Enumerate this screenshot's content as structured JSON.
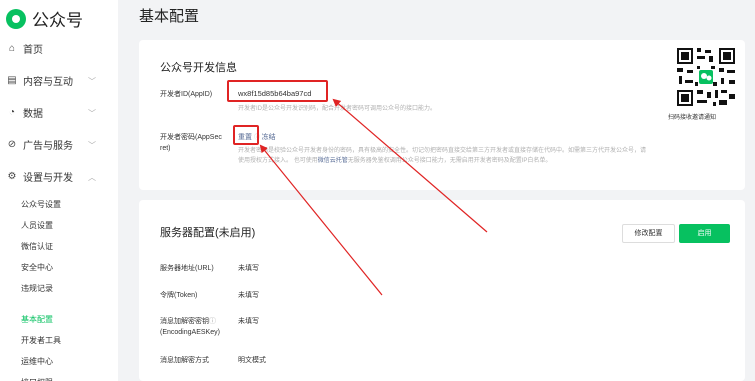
{
  "brand": {
    "name": "公众号"
  },
  "page": {
    "title": "基本配置"
  },
  "sidebar": {
    "items": [
      {
        "label": "首页",
        "icon": "home-icon"
      },
      {
        "label": "内容与互动",
        "icon": "document-icon"
      },
      {
        "label": "数据",
        "icon": "chart-icon"
      },
      {
        "label": "广告与服务",
        "icon": "compass-icon"
      },
      {
        "label": "设置与开发",
        "icon": "gear-icon"
      }
    ],
    "sub_items": [
      "公众号设置",
      "人员设置",
      "微信认证",
      "安全中心",
      "违规记录"
    ],
    "dev_items": [
      "基本配置",
      "开发者工具",
      "运维中心",
      "接口权限"
    ]
  },
  "dev_info": {
    "title": "公众号开发信息",
    "appid_label": "开发者ID(AppID)",
    "appid_value": "wx8f15d85b64ba97cd",
    "appid_hint": "开发者ID是公众号开发识别码，配合开发者密码可调用公众号的接口能力。",
    "secret_label_1": "开发者密码(AppSec",
    "secret_label_2": "ret)",
    "reset_label": "重置",
    "freeze_label": "冻结",
    "secret_hint_1": "开发者密码是校验公众号开发者身份的密码，具有极高的安全性。切记勿把密码直接交给第三方开发者或直接存储在代码中。如需第三方代开发公众号，请",
    "secret_hint_2a": "使用授权方式接入。",
    "secret_hint_2b": "也可使用",
    "secret_hint_2link": "微信云托管",
    "secret_hint_2c": "无服务器免鉴权调用公众号接口能力，无需启用开发者密码及配置IP白名单。",
    "qr_caption": "扫码接收邀请通知"
  },
  "server_config": {
    "title": "服务器配置(未启用)",
    "modify_button": "修改配置",
    "enable_button": "启用",
    "rows": [
      {
        "label": "服务器地址(URL)",
        "value": "未填写"
      },
      {
        "label": "令牌(Token)",
        "value": "未填写"
      },
      {
        "label": "消息加解密密钥",
        "label2": "(EncodingAESKey)",
        "value": "未填写"
      },
      {
        "label": "消息加解密方式",
        "value": "明文模式"
      }
    ]
  },
  "colors": {
    "brand_green": "#07c160",
    "annotation_red": "#e02424",
    "link_blue": "#576b95"
  }
}
